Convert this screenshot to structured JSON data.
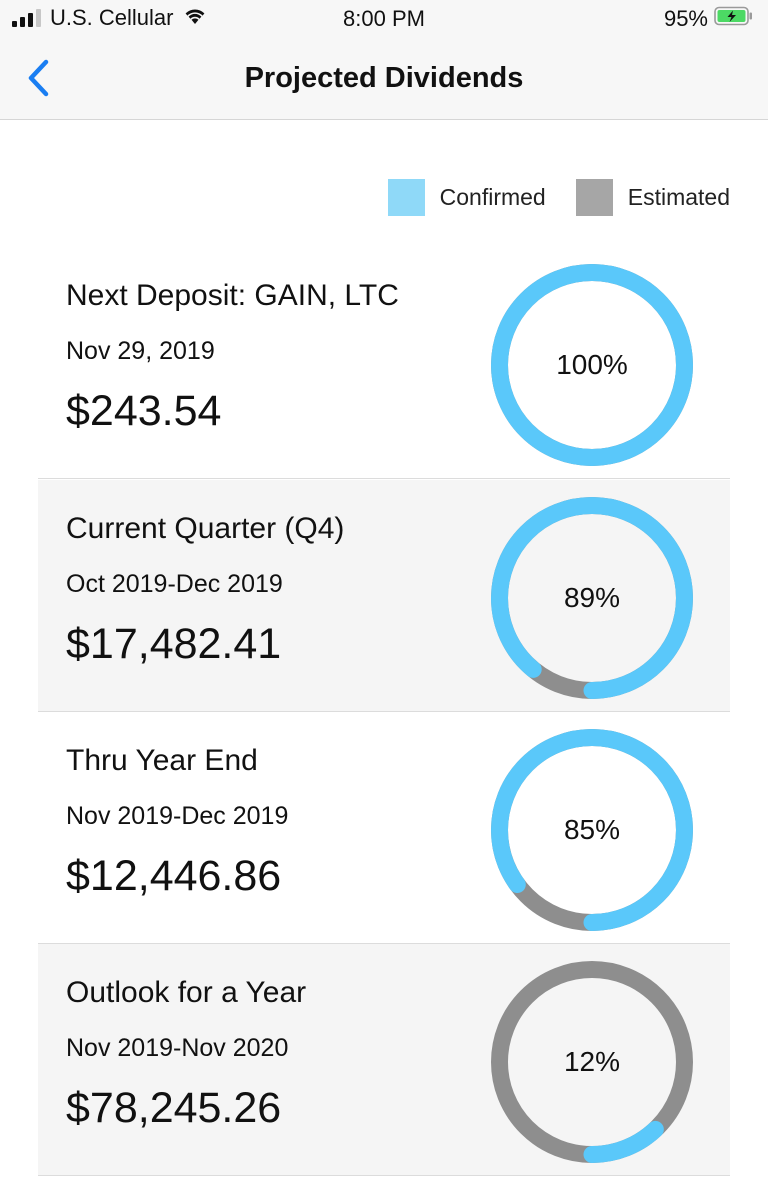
{
  "status": {
    "carrier": "U.S. Cellular",
    "time": "8:00 PM",
    "battery": "95%"
  },
  "nav": {
    "title": "Projected Dividends",
    "back_icon": "chevron-left-icon"
  },
  "legend": {
    "confirmed_label": "Confirmed",
    "estimated_label": "Estimated"
  },
  "colors": {
    "confirmed": "#5ac8fa",
    "estimated": "#8e8e8e",
    "legend_confirmed": "#8fd9f8",
    "legend_estimated": "#a6a6a6",
    "accent": "#1a7ef2"
  },
  "cards": [
    {
      "title": "Next Deposit: GAIN, LTC",
      "range": "Nov 29, 2019",
      "amount": "$243.54",
      "percent_label": "100%",
      "confirmed_fraction": 1.0
    },
    {
      "title": "Current Quarter (Q4)",
      "range": "Oct 2019-Dec 2019",
      "amount": "$17,482.41",
      "percent_label": "89%",
      "confirmed_fraction": 0.89
    },
    {
      "title": "Thru Year End",
      "range": "Nov 2019-Dec 2019",
      "amount": "$12,446.86",
      "percent_label": "85%",
      "confirmed_fraction": 0.85
    },
    {
      "title": "Outlook for a Year",
      "range": "Nov 2019-Nov 2020",
      "amount": "$78,245.26",
      "percent_label": "12%",
      "confirmed_fraction": 0.12
    }
  ]
}
